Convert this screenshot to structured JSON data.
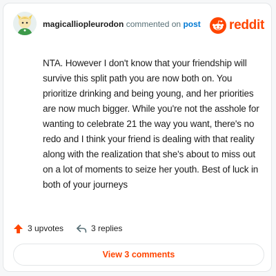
{
  "comment": {
    "username": "magicalliopleurodon",
    "action_text": "commented on",
    "target_link": "post",
    "body": "NTA. However I don't know that your friendship will survive this split path you are now both on. You prioritize drinking and being young, and her priorities are now much bigger. While you're not the asshole for wanting to celebrate 21 the way you want, there's no redo and I think your friend is dealing with that reality along with the realization that she's about to miss out on a lot of moments to seize her youth. Best of luck in both of your journeys",
    "upvotes_label": "3 upvotes",
    "replies_label": "3 replies",
    "view_comments_label": "View 3 comments"
  },
  "brand": {
    "wordmark": "reddit",
    "accent_color": "#ff4500",
    "link_color": "#0079d3"
  },
  "icons": {
    "avatar": "avatar",
    "logo": "reddit-alien-icon",
    "upvote": "upvote-arrow-icon",
    "reply": "reply-arrow-icon"
  }
}
